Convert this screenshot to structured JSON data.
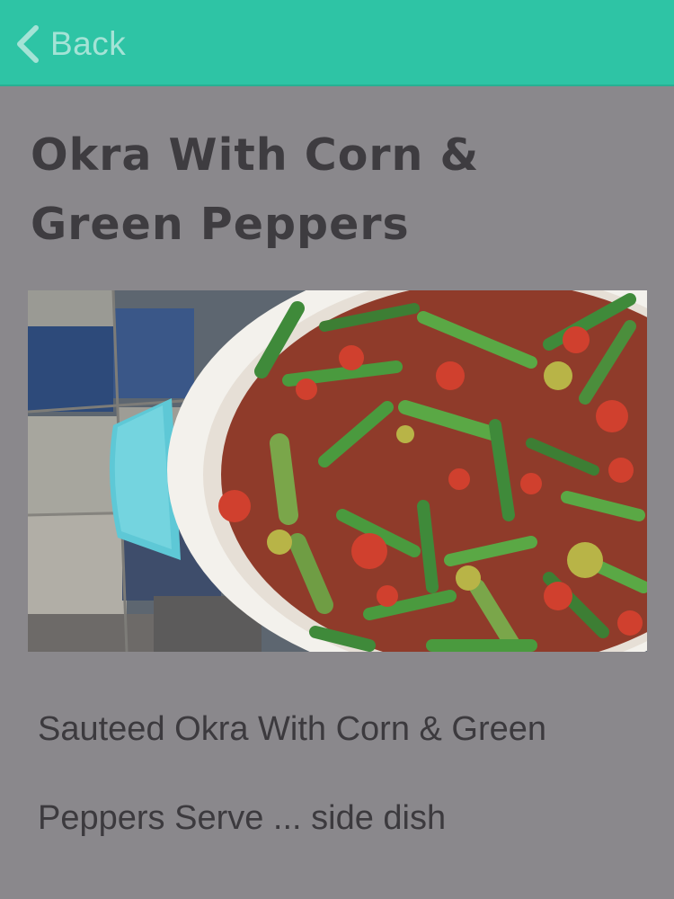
{
  "header": {
    "back_label": "Back",
    "bar_color": "#2ec4a5",
    "back_icon": "chevron-left-icon"
  },
  "page": {
    "title": "Okra With Corn & Green Peppers",
    "image_description_icon": "recipe-photo",
    "body_text": "Sauteed Okra With Corn & Green Peppers Serve ... side dish"
  }
}
